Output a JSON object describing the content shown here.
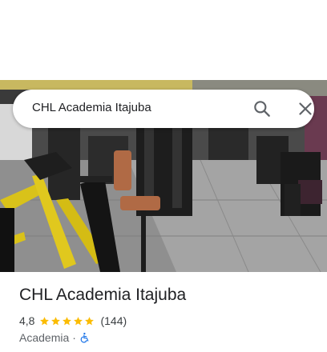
{
  "search": {
    "query": "CHL Academia Itajuba"
  },
  "place": {
    "title": "CHL Academia Itajuba",
    "rating": "4,8",
    "stars": 5,
    "review_count": "(144)",
    "category": "Academia",
    "separator": "·"
  },
  "icons": {
    "search": "search-icon",
    "close": "close-icon",
    "star": "star-icon",
    "accessibility": "wheelchair-accessible-icon"
  },
  "colors": {
    "star": "#fbbc04",
    "accessibility": "#1a73e8",
    "title": "#202124",
    "subtext": "#5f6368"
  }
}
